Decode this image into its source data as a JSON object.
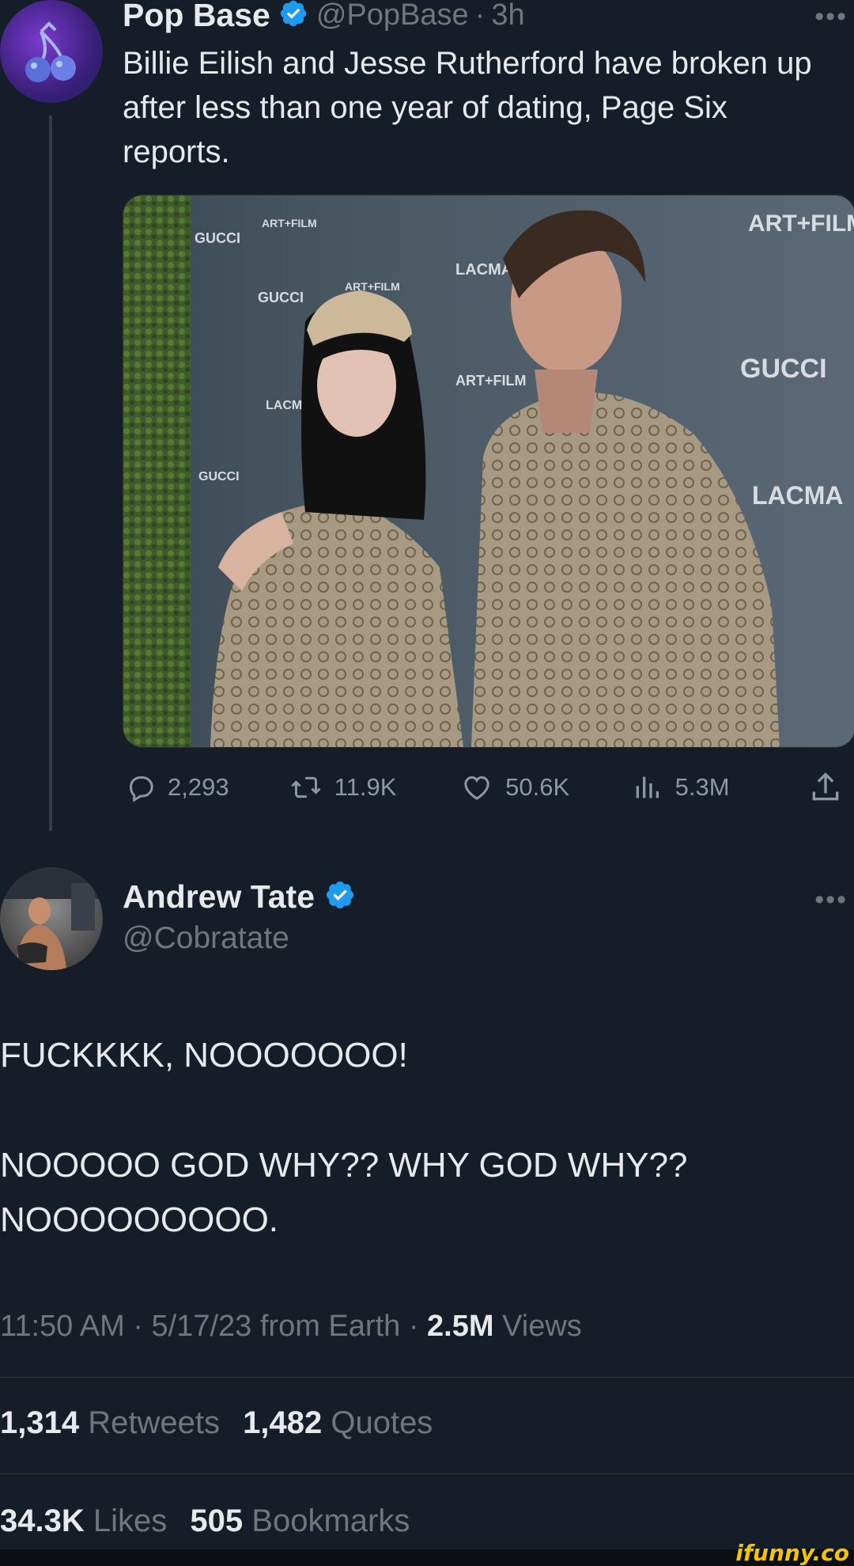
{
  "tweet1": {
    "name": "Pop Base",
    "handle": "@PopBase",
    "time": "3h",
    "text": "Billie Eilish and Jesse Rutherford have broken up after less than one year of dating, Page Six reports.",
    "photo_signage": [
      "GUCCI",
      "ART+FILM",
      "LACMA"
    ],
    "actions": {
      "replies": "2,293",
      "retweets": "11.9K",
      "likes": "50.6K",
      "views": "5.3M"
    }
  },
  "tweet2": {
    "name": "Andrew Tate",
    "handle": "@Cobratate",
    "text_line1": "FUCKKKK, NOOOOOOO!",
    "text_line2": "NOOOOO GOD WHY?? WHY GOD WHY??",
    "text_line3": "NOOOOOOOOO.",
    "meta": {
      "time": "11:50 AM",
      "date": "5/17/23",
      "source": "from Earth",
      "views_count": "2.5M",
      "views_label": "Views"
    },
    "stats": {
      "retweets_count": "1,314",
      "retweets_label": "Retweets",
      "quotes_count": "1,482",
      "quotes_label": "Quotes",
      "likes_count": "34.3K",
      "likes_label": "Likes",
      "bookmarks_count": "505",
      "bookmarks_label": "Bookmarks"
    }
  },
  "more_label": "•••",
  "watermark": "ifunny.co",
  "colors": {
    "background": "#151d28",
    "verified": "#1d9bf0",
    "muted": "#71767b",
    "text": "#e7e9ea"
  }
}
